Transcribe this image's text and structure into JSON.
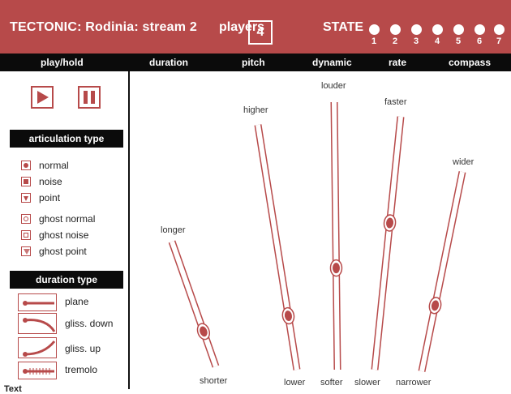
{
  "header": {
    "title": "TECTONIC: Rodinia: stream 2",
    "players_label": "players",
    "players_value": "4",
    "state_label": "STATE",
    "state_numbers": [
      "1",
      "2",
      "3",
      "4",
      "5",
      "6",
      "7"
    ]
  },
  "columns": [
    "play/hold",
    "duration",
    "pitch",
    "dynamic",
    "rate",
    "compass"
  ],
  "left_panel": {
    "articulation_header": "articulation type",
    "articulation_items": [
      "normal",
      "noise",
      "point",
      "ghost normal",
      "ghost noise",
      "ghost point"
    ],
    "duration_header": "duration type",
    "duration_items": [
      "plane",
      "gliss. down",
      "gliss. up",
      "tremolo"
    ],
    "bottom_label": "Text"
  },
  "sliders": {
    "duration": {
      "top": "longer",
      "bottom": "shorter",
      "value": 0.28
    },
    "pitch": {
      "top": "higher",
      "bottom": "lower",
      "value": 0.22
    },
    "dynamic": {
      "top": "louder",
      "bottom": "softer",
      "value": 0.38
    },
    "rate": {
      "top": "faster",
      "bottom": "slower",
      "value": 0.58
    },
    "compass": {
      "top": "wider",
      "bottom": "narrower",
      "value": 0.33
    }
  },
  "colors": {
    "accent": "#b74a4a",
    "header_bg": "#0b0b0b"
  }
}
